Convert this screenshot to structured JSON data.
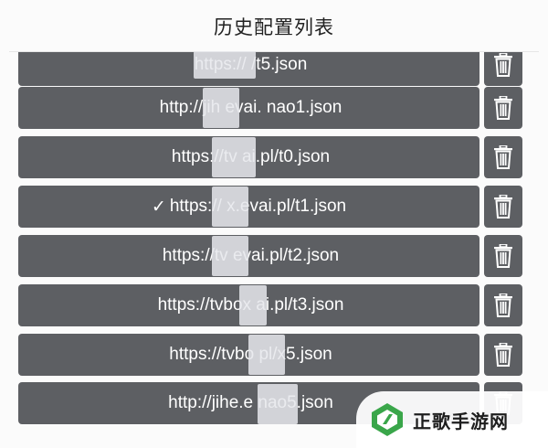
{
  "dialog": {
    "title": "历史配置列表"
  },
  "items": [
    {
      "check": "",
      "url": "https://                /t5.json"
    },
    {
      "check": "",
      "url": "http://jih    evai.    nao1.json"
    },
    {
      "check": "",
      "url": "https://tv        ai.pl/t0.json"
    },
    {
      "check": "✓",
      "url": "https://     x.evai.pl/t1.json"
    },
    {
      "check": "",
      "url": "https://tv     evai.pl/t2.json"
    },
    {
      "check": "",
      "url": "https://tvbox    ai.pl/t3.json"
    },
    {
      "check": "",
      "url": "https://tvbo        pl/x5.json"
    },
    {
      "check": "",
      "url": "http://jihe.e         nao5.json"
    }
  ],
  "watermark": {
    "text": "正歌手游网"
  },
  "colors": {
    "row_bg": "#5d5f63",
    "dialog_bg": "#fbfbfb",
    "watermark_green": "#3aa64a"
  },
  "icons": {
    "delete": "trash-icon",
    "logo": "watermark-logo-icon"
  }
}
